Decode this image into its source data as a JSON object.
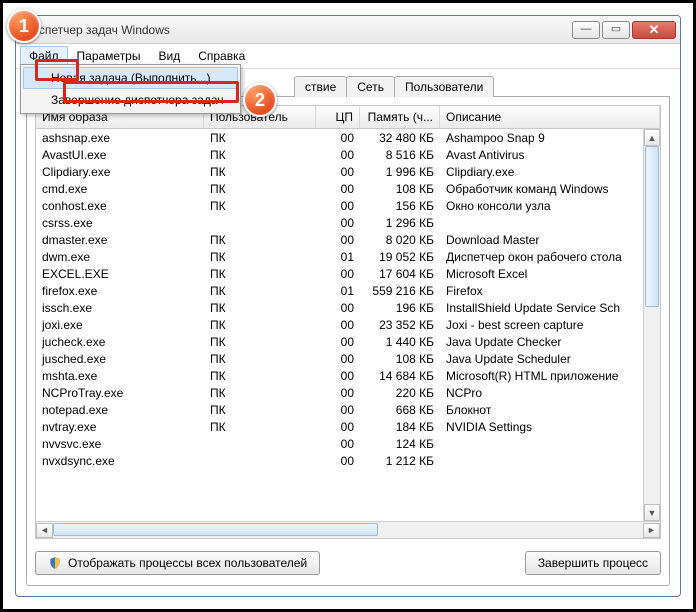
{
  "window": {
    "title": "Диспетчер задач Windows"
  },
  "menubar": [
    "Файл",
    "Параметры",
    "Вид",
    "Справка"
  ],
  "file_menu": {
    "item1": "Новая задача (Выполнить...)",
    "item2": "Завершение диспетчера задач"
  },
  "tabs": {
    "visible": [
      "ствие",
      "Сеть",
      "Пользователи"
    ]
  },
  "columns": {
    "name": "Имя образа",
    "user": "Пользователь",
    "cpu": "ЦП",
    "mem": "Память (ч...",
    "desc": "Описание"
  },
  "processes": [
    {
      "name": "ashsnap.exe",
      "user": "ПК",
      "cpu": "00",
      "mem": "32 480 КБ",
      "desc": "Ashampoo Snap 9"
    },
    {
      "name": "AvastUI.exe",
      "user": "ПК",
      "cpu": "00",
      "mem": "8 516 КБ",
      "desc": "Avast Antivirus"
    },
    {
      "name": "Clipdiary.exe",
      "user": "ПК",
      "cpu": "00",
      "mem": "1 996 КБ",
      "desc": "Clipdiary.exe"
    },
    {
      "name": "cmd.exe",
      "user": "ПК",
      "cpu": "00",
      "mem": "108 КБ",
      "desc": "Обработчик команд Windows"
    },
    {
      "name": "conhost.exe",
      "user": "ПК",
      "cpu": "00",
      "mem": "156 КБ",
      "desc": "Окно консоли узла"
    },
    {
      "name": "csrss.exe",
      "user": "",
      "cpu": "00",
      "mem": "1 296 КБ",
      "desc": ""
    },
    {
      "name": "dmaster.exe",
      "user": "ПК",
      "cpu": "00",
      "mem": "8 020 КБ",
      "desc": "Download Master"
    },
    {
      "name": "dwm.exe",
      "user": "ПК",
      "cpu": "01",
      "mem": "19 052 КБ",
      "desc": "Диспетчер окон рабочего стола"
    },
    {
      "name": "EXCEL.EXE",
      "user": "ПК",
      "cpu": "00",
      "mem": "17 604 КБ",
      "desc": "Microsoft Excel"
    },
    {
      "name": "firefox.exe",
      "user": "ПК",
      "cpu": "01",
      "mem": "559 216 КБ",
      "desc": "Firefox"
    },
    {
      "name": "issch.exe",
      "user": "ПК",
      "cpu": "00",
      "mem": "196 КБ",
      "desc": "InstallShield Update Service Sch"
    },
    {
      "name": "joxi.exe",
      "user": "ПК",
      "cpu": "00",
      "mem": "23 352 КБ",
      "desc": "Joxi - best screen capture"
    },
    {
      "name": "jucheck.exe",
      "user": "ПК",
      "cpu": "00",
      "mem": "1 440 КБ",
      "desc": "Java Update Checker"
    },
    {
      "name": "jusched.exe",
      "user": "ПК",
      "cpu": "00",
      "mem": "108 КБ",
      "desc": "Java Update Scheduler"
    },
    {
      "name": "mshta.exe",
      "user": "ПК",
      "cpu": "00",
      "mem": "14 684 КБ",
      "desc": "Microsoft(R) HTML приложение"
    },
    {
      "name": "NCProTray.exe",
      "user": "ПК",
      "cpu": "00",
      "mem": "220 КБ",
      "desc": "NCPro"
    },
    {
      "name": "notepad.exe",
      "user": "ПК",
      "cpu": "00",
      "mem": "668 КБ",
      "desc": "Блокнот"
    },
    {
      "name": "nvtray.exe",
      "user": "ПК",
      "cpu": "00",
      "mem": "184 КБ",
      "desc": "NVIDIA Settings"
    },
    {
      "name": "nvvsvc.exe",
      "user": "",
      "cpu": "00",
      "mem": "124 КБ",
      "desc": ""
    },
    {
      "name": "nvxdsync.exe",
      "user": "",
      "cpu": "00",
      "mem": "1 212 КБ",
      "desc": ""
    }
  ],
  "buttons": {
    "show_all": "Отображать процессы всех пользователей",
    "end": "Завершить процесс"
  },
  "callouts": {
    "one": "1",
    "two": "2"
  }
}
